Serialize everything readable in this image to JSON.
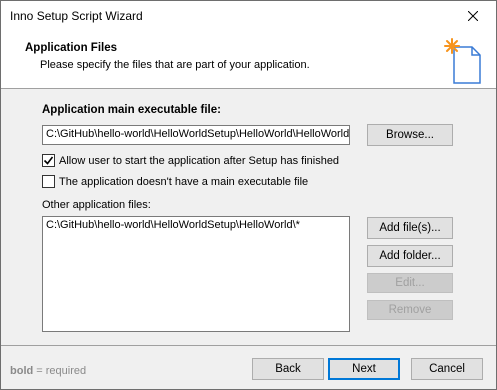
{
  "window": {
    "title": "Inno Setup Script Wizard"
  },
  "header": {
    "title": "Application Files",
    "subtitle": "Please specify the files that are part of your application."
  },
  "main_executable": {
    "label": "Application main executable file:",
    "value": "C:\\GitHub\\hello-world\\HelloWorldSetup\\HelloWorld\\HelloWorld.exe",
    "browse_label": "Browse..."
  },
  "options": {
    "allow_start": {
      "label": "Allow user to start the application after Setup has finished",
      "checked": true
    },
    "no_main_exe": {
      "label": "The application doesn't have a main executable file",
      "checked": false
    }
  },
  "other_files": {
    "label": "Other application files:",
    "items": [
      "C:\\GitHub\\hello-world\\HelloWorldSetup\\HelloWorld\\*"
    ],
    "add_files_label": "Add file(s)...",
    "add_folder_label": "Add folder...",
    "edit_label": "Edit...",
    "remove_label": "Remove"
  },
  "footer": {
    "hint_bold": "bold",
    "hint_rest": " = required",
    "back_label": "Back",
    "next_label": "Next",
    "cancel_label": "Cancel"
  },
  "colors": {
    "accent": "#0078d7",
    "icon_orange": "#f7941d"
  }
}
